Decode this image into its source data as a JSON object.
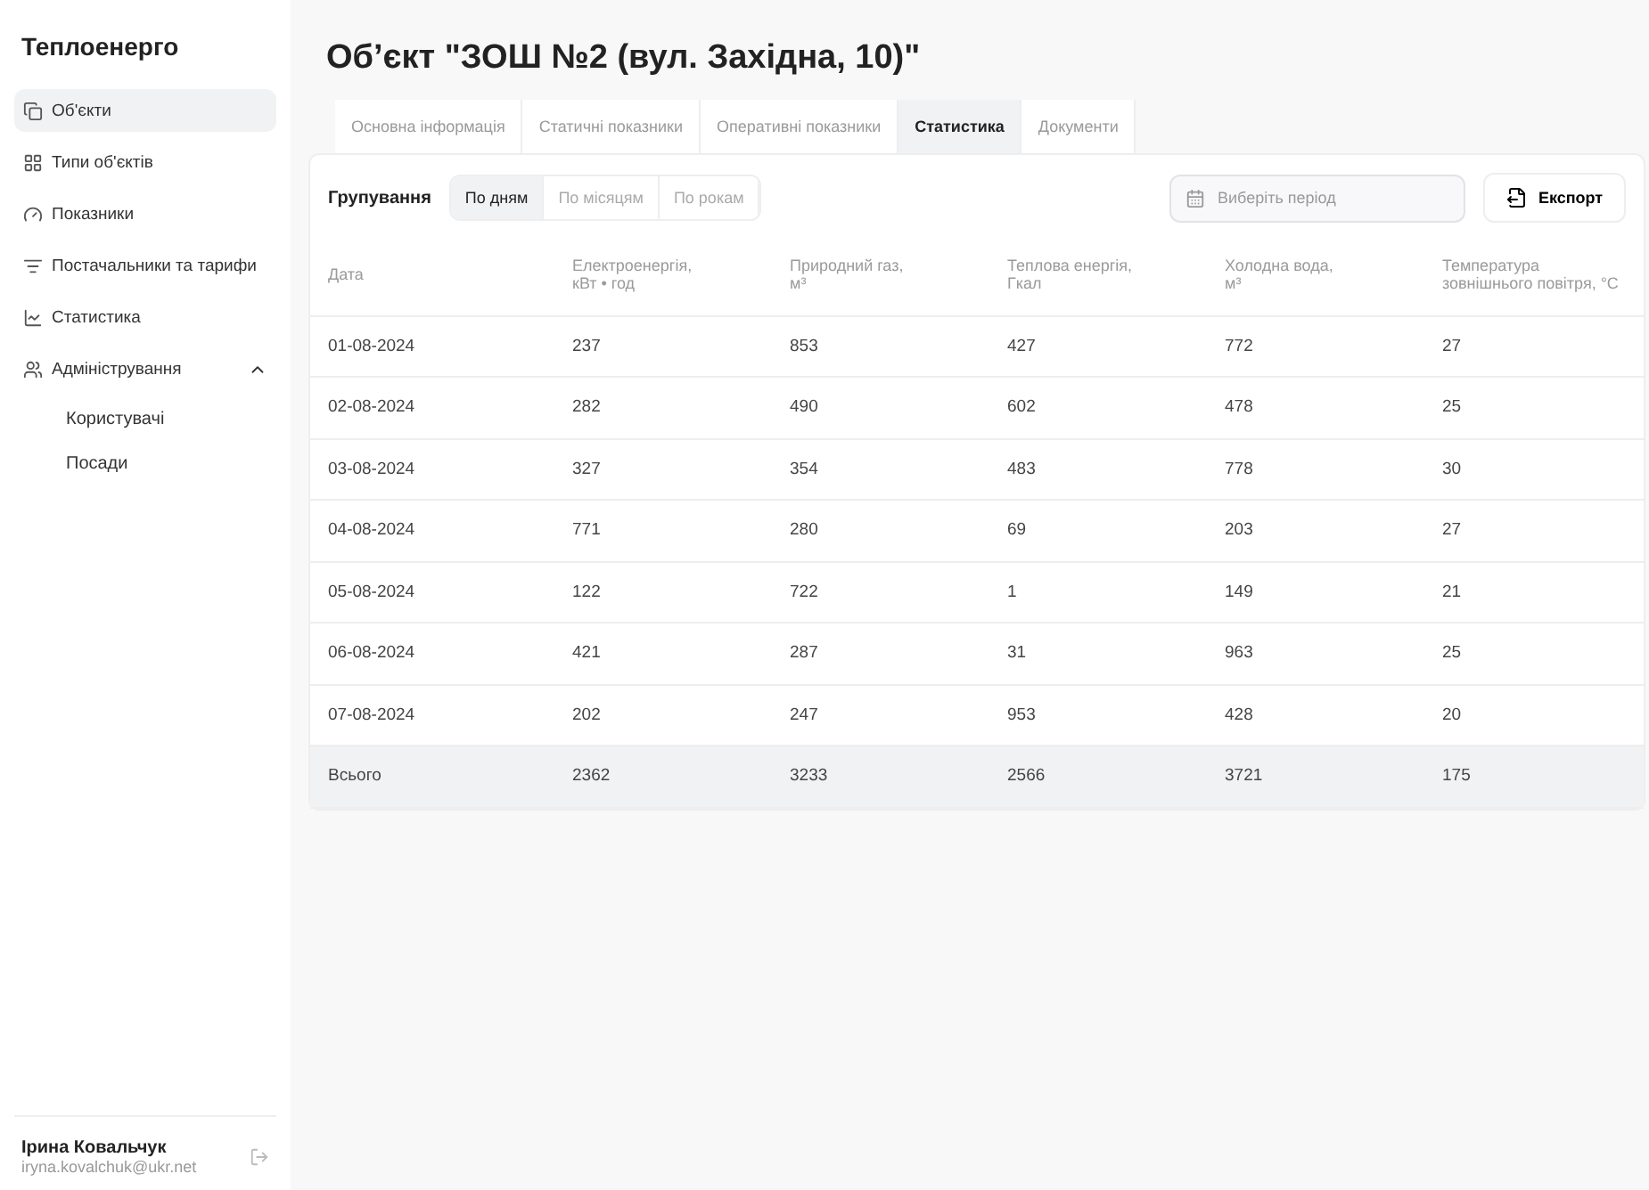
{
  "sidebar": {
    "brand": "Теплоенерго",
    "items": [
      {
        "label": "Об'єкти",
        "selected": true
      },
      {
        "label": "Типи об'єктів",
        "selected": false
      },
      {
        "label": "Показники",
        "selected": false
      },
      {
        "label": "Постачальники та тарифи",
        "selected": false
      },
      {
        "label": "Статистика",
        "selected": false
      },
      {
        "label": "Адміністрування",
        "selected": false,
        "expanded": true,
        "children": [
          {
            "label": "Користувачі",
            "selected": false
          },
          {
            "label": "Посади",
            "selected": false
          }
        ]
      }
    ],
    "user": {
      "name": "Ірина Ковальчук",
      "email": "iryna.kovalchuk@ukr.net"
    }
  },
  "page": {
    "title": "Об’єкт \"ЗОШ №2 (вул. Західна, 10)\"",
    "tabs": [
      {
        "label": "Основна інформація",
        "selected": false
      },
      {
        "label": "Статичні показники",
        "selected": false
      },
      {
        "label": "Оперативні показники",
        "selected": false
      },
      {
        "label": "Статистика",
        "selected": true
      },
      {
        "label": "Документи",
        "selected": false
      }
    ],
    "grouping": {
      "label": "Групування",
      "options": [
        {
          "label": "По дням",
          "selected": true
        },
        {
          "label": "По місяцям",
          "selected": false
        },
        {
          "label": "По рокам",
          "selected": false
        }
      ]
    },
    "period": {
      "placeholder": "Виберіть період"
    },
    "export": "Експорт",
    "table": {
      "columns": [
        "Дата",
        "Електроенергія, кВт • год",
        "Природний газ, м³",
        "Теплова енергія, Гкал",
        "Холодна вода, м³",
        "Температура зовнішнього повітря, °С"
      ],
      "rows": [
        [
          "01-08-2024",
          "237",
          "853",
          "427",
          "772",
          "27"
        ],
        [
          "02-08-2024",
          "282",
          "490",
          "602",
          "478",
          "25"
        ],
        [
          "03-08-2024",
          "327",
          "354",
          "483",
          "778",
          "30"
        ],
        [
          "04-08-2024",
          "771",
          "280",
          "69",
          "203",
          "27"
        ],
        [
          "05-08-2024",
          "122",
          "722",
          "1",
          "149",
          "21"
        ],
        [
          "06-08-2024",
          "421",
          "287",
          "31",
          "963",
          "25"
        ],
        [
          "07-08-2024",
          "202",
          "247",
          "953",
          "428",
          "20"
        ]
      ],
      "total": [
        "Всього",
        "2362",
        "3233",
        "2566",
        "3721",
        "175"
      ]
    }
  }
}
